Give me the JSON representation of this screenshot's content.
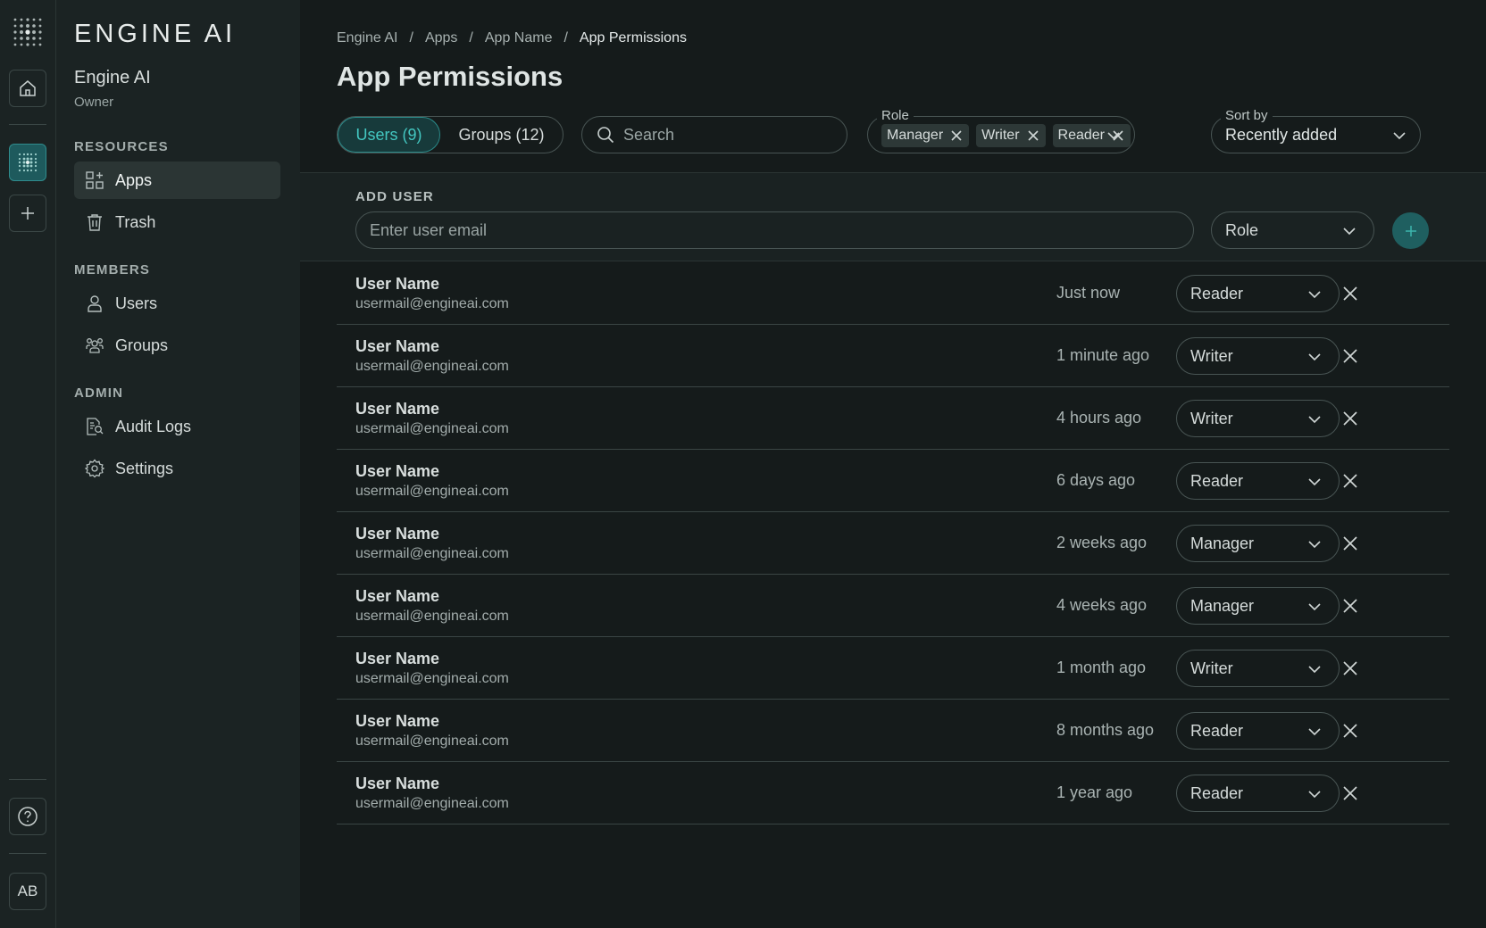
{
  "rail": {
    "avatar_initials": "AB"
  },
  "sidebar": {
    "brand": "ENGINE AI",
    "org_name": "Engine AI",
    "org_role": "Owner",
    "sections": {
      "resources": "RESOURCES",
      "members": "MEMBERS",
      "admin": "ADMIN"
    },
    "items": {
      "apps": "Apps",
      "trash": "Trash",
      "users": "Users",
      "groups": "Groups",
      "audit_logs": "Audit Logs",
      "settings": "Settings"
    }
  },
  "breadcrumb": [
    "Engine AI",
    "Apps",
    "App Name",
    "App Permissions"
  ],
  "page_title": "App Permissions",
  "tabs": {
    "users": "Users (9)",
    "groups": "Groups (12)"
  },
  "search": {
    "placeholder": "Search",
    "value": ""
  },
  "role_filter": {
    "label": "Role",
    "chips": [
      "Manager",
      "Writer",
      "Reader"
    ]
  },
  "sort": {
    "label": "Sort by",
    "value": "Recently added"
  },
  "add_user": {
    "heading": "ADD USER",
    "email_placeholder": "Enter user email",
    "role_placeholder": "Role"
  },
  "users": [
    {
      "name": "User Name",
      "email": "usermail@engineai.com",
      "added": "Just now",
      "role": "Reader"
    },
    {
      "name": "User Name",
      "email": "usermail@engineai.com",
      "added": "1 minute ago",
      "role": "Writer"
    },
    {
      "name": "User Name",
      "email": "usermail@engineai.com",
      "added": "4 hours ago",
      "role": "Writer"
    },
    {
      "name": "User Name",
      "email": "usermail@engineai.com",
      "added": "6 days ago",
      "role": "Reader"
    },
    {
      "name": "User Name",
      "email": "usermail@engineai.com",
      "added": "2 weeks ago",
      "role": "Manager"
    },
    {
      "name": "User Name",
      "email": "usermail@engineai.com",
      "added": "4 weeks ago",
      "role": "Manager"
    },
    {
      "name": "User Name",
      "email": "usermail@engineai.com",
      "added": "1 month ago",
      "role": "Writer"
    },
    {
      "name": "User Name",
      "email": "usermail@engineai.com",
      "added": "8 months ago",
      "role": "Reader"
    },
    {
      "name": "User Name",
      "email": "usermail@engineai.com",
      "added": "1 year ago",
      "role": "Reader"
    }
  ],
  "colors": {
    "background": "#151b1b",
    "sidebar": "#1b2323",
    "accent": "#43c7c1",
    "accent_dark": "#1f5f60",
    "border": "#485453"
  },
  "icons": {
    "rail": [
      "app-grid-logo-icon",
      "home-icon",
      "workspace-grid-icon",
      "plus-icon",
      "help-icon"
    ],
    "nav": [
      "apps-icon",
      "trash-icon",
      "user-icon",
      "group-icon",
      "audit-log-icon",
      "gear-icon"
    ],
    "controls": [
      "search-icon",
      "close-icon",
      "chevron-down-icon",
      "plus-icon"
    ]
  }
}
